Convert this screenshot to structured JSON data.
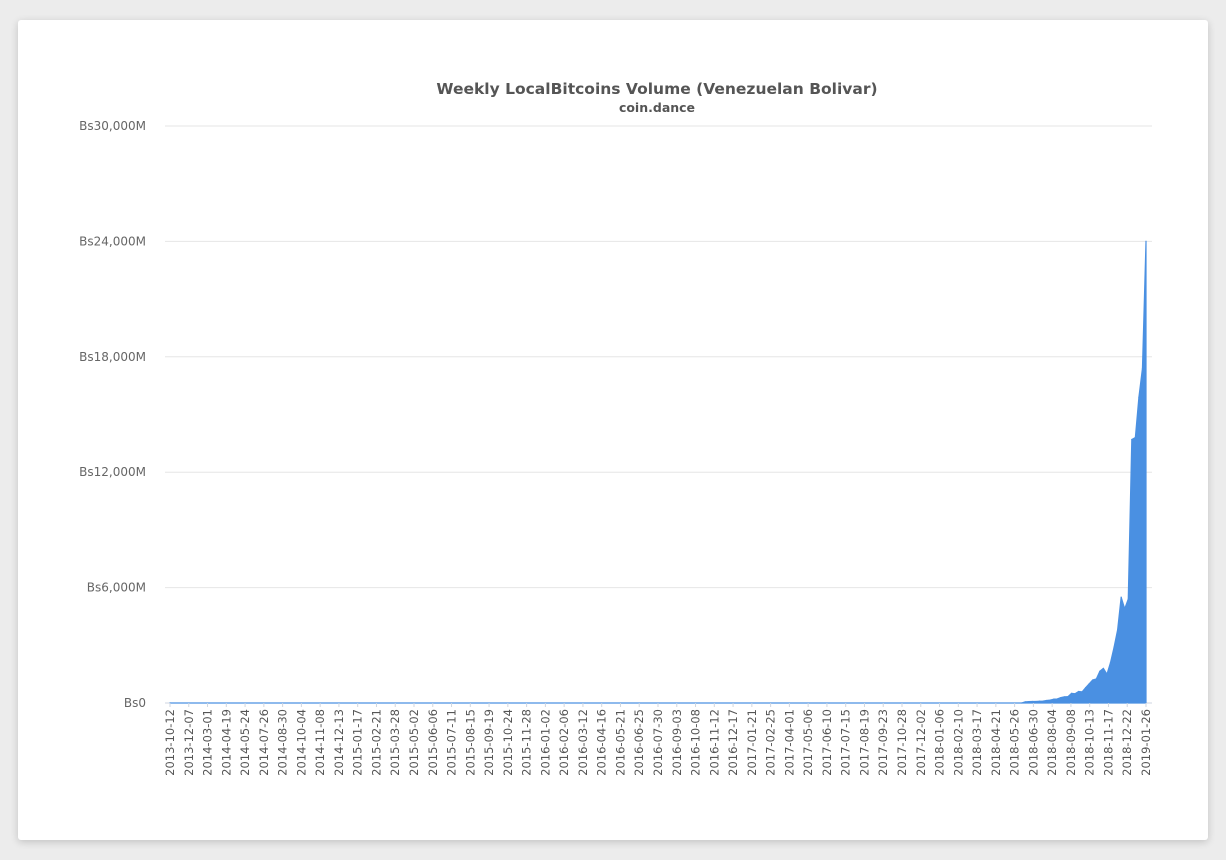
{
  "chart_data": {
    "type": "area",
    "title": "Weekly LocalBitcoins Volume (Venezuelan Bolivar)",
    "subtitle": "coin.dance",
    "xlabel": "",
    "ylabel": "",
    "ylim": [
      0,
      30000
    ],
    "y_unit": "Bs millions",
    "y_ticks": [
      0,
      6000,
      12000,
      18000,
      24000,
      30000
    ],
    "y_tick_labels": [
      "Bs0",
      "Bs6,000M",
      "Bs12,000M",
      "Bs18,000M",
      "Bs24,000M",
      "Bs30,000M"
    ],
    "grid": true,
    "legend": "none",
    "color": "#4a90e2",
    "x_tick_labels": [
      "2013-10-12",
      "2013-12-07",
      "2014-03-01",
      "2014-04-19",
      "2014-05-24",
      "2014-07-26",
      "2014-08-30",
      "2014-10-04",
      "2014-11-08",
      "2014-12-13",
      "2015-01-17",
      "2015-02-21",
      "2015-03-28",
      "2015-05-02",
      "2015-06-06",
      "2015-07-11",
      "2015-08-15",
      "2015-09-19",
      "2015-10-24",
      "2015-11-28",
      "2016-01-02",
      "2016-02-06",
      "2016-03-12",
      "2016-04-16",
      "2016-05-21",
      "2016-06-25",
      "2016-07-30",
      "2016-09-03",
      "2016-10-08",
      "2016-11-12",
      "2016-12-17",
      "2017-01-21",
      "2017-02-25",
      "2017-04-01",
      "2017-05-06",
      "2017-06-10",
      "2017-07-15",
      "2017-08-19",
      "2017-09-23",
      "2017-10-28",
      "2017-12-02",
      "2018-01-06",
      "2018-02-10",
      "2018-03-17",
      "2018-04-21",
      "2018-05-26",
      "2018-06-30",
      "2018-08-04",
      "2018-09-08",
      "2018-10-13",
      "2018-11-17",
      "2018-12-22",
      "2019-01-26"
    ],
    "series": [
      {
        "points": [
          {
            "x": "2013-10-12",
            "y": 0
          },
          {
            "x": "2018-05-19",
            "y": 0
          },
          {
            "x": "2018-05-26",
            "y": 60
          },
          {
            "x": "2018-06-02",
            "y": 70
          },
          {
            "x": "2018-06-09",
            "y": 80
          },
          {
            "x": "2018-06-16",
            "y": 80
          },
          {
            "x": "2018-06-23",
            "y": 90
          },
          {
            "x": "2018-06-30",
            "y": 100
          },
          {
            "x": "2018-07-07",
            "y": 130
          },
          {
            "x": "2018-07-14",
            "y": 150
          },
          {
            "x": "2018-07-21",
            "y": 200
          },
          {
            "x": "2018-07-28",
            "y": 210
          },
          {
            "x": "2018-08-04",
            "y": 280
          },
          {
            "x": "2018-08-11",
            "y": 320
          },
          {
            "x": "2018-08-18",
            "y": 330
          },
          {
            "x": "2018-08-25",
            "y": 500
          },
          {
            "x": "2018-09-01",
            "y": 480
          },
          {
            "x": "2018-09-08",
            "y": 600
          },
          {
            "x": "2018-09-15",
            "y": 580
          },
          {
            "x": "2018-09-22",
            "y": 800
          },
          {
            "x": "2018-09-29",
            "y": 1000
          },
          {
            "x": "2018-10-06",
            "y": 1200
          },
          {
            "x": "2018-10-13",
            "y": 1250
          },
          {
            "x": "2018-10-20",
            "y": 1650
          },
          {
            "x": "2018-10-27",
            "y": 1800
          },
          {
            "x": "2018-11-03",
            "y": 1500
          },
          {
            "x": "2018-11-10",
            "y": 2100
          },
          {
            "x": "2018-11-17",
            "y": 2900
          },
          {
            "x": "2018-11-24",
            "y": 3800
          },
          {
            "x": "2018-12-01",
            "y": 5500
          },
          {
            "x": "2018-12-08",
            "y": 4900
          },
          {
            "x": "2018-12-15",
            "y": 5400
          },
          {
            "x": "2018-12-22",
            "y": 13700
          },
          {
            "x": "2018-12-29",
            "y": 13800
          },
          {
            "x": "2019-01-05",
            "y": 15900
          },
          {
            "x": "2019-01-12",
            "y": 17400
          },
          {
            "x": "2019-01-19",
            "y": 24000
          }
        ]
      }
    ]
  }
}
